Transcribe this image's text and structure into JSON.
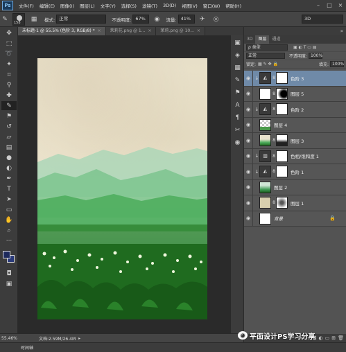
{
  "app": {
    "logo": "Ps"
  },
  "menu": [
    "文件(F)",
    "编辑(E)",
    "图像(I)",
    "图层(L)",
    "文字(Y)",
    "选择(S)",
    "滤镜(T)",
    "3D(D)",
    "视图(V)",
    "窗口(W)",
    "帮助(H)"
  ],
  "options": {
    "brush_size": "158",
    "mode_label": "模式:",
    "mode_value": "正常",
    "opacity_label": "不透明度:",
    "opacity_value": "67%",
    "flow_label": "流量:",
    "flow_value": "41%",
    "workspace": "3D"
  },
  "tabs": [
    {
      "label": "未标题-1 @ 55.5% (色阶 3, RGB/8) *",
      "close": "×"
    },
    {
      "label": "茉莉花.png @ 1...",
      "close": "×"
    },
    {
      "label": "茉莉.png @ 10...",
      "close": "×"
    }
  ],
  "status": {
    "zoom": "55.46%",
    "doc": "文档:2.59M/26.4M",
    "timeline": "时间轴"
  },
  "panel": {
    "tabs": [
      "3D",
      "图层",
      "通道"
    ],
    "filter_kind": "ρ 类型",
    "blend_mode": "正常",
    "opacity_label": "不透明度:",
    "opacity_value": "100%",
    "lock_label": "锁定:",
    "fill_label": "填充:",
    "fill_value": "100%"
  },
  "layers": [
    {
      "name": "色阶 3",
      "type": "adjustment",
      "selected": true
    },
    {
      "name": "图层 5",
      "type": "masked",
      "selected": false
    },
    {
      "name": "色阶 2",
      "type": "adjustment",
      "selected": false
    },
    {
      "name": "图层 4",
      "type": "pixel",
      "selected": false
    },
    {
      "name": "图层 3",
      "type": "masked",
      "selected": false
    },
    {
      "name": "色相/饱和度 1",
      "type": "adjustment",
      "selected": false
    },
    {
      "name": "色阶 1",
      "type": "adjustment",
      "selected": false
    },
    {
      "name": "图层 2",
      "type": "pixel",
      "selected": false
    },
    {
      "name": "图层 1",
      "type": "masked",
      "selected": false
    },
    {
      "name": "背景",
      "type": "background",
      "selected": false
    }
  ],
  "watermark": "平面设计PS学习分享",
  "colors": {
    "foreground": "#1d2a5c",
    "background": "#2a3a7a",
    "selected_layer": "#6f8aa8"
  }
}
